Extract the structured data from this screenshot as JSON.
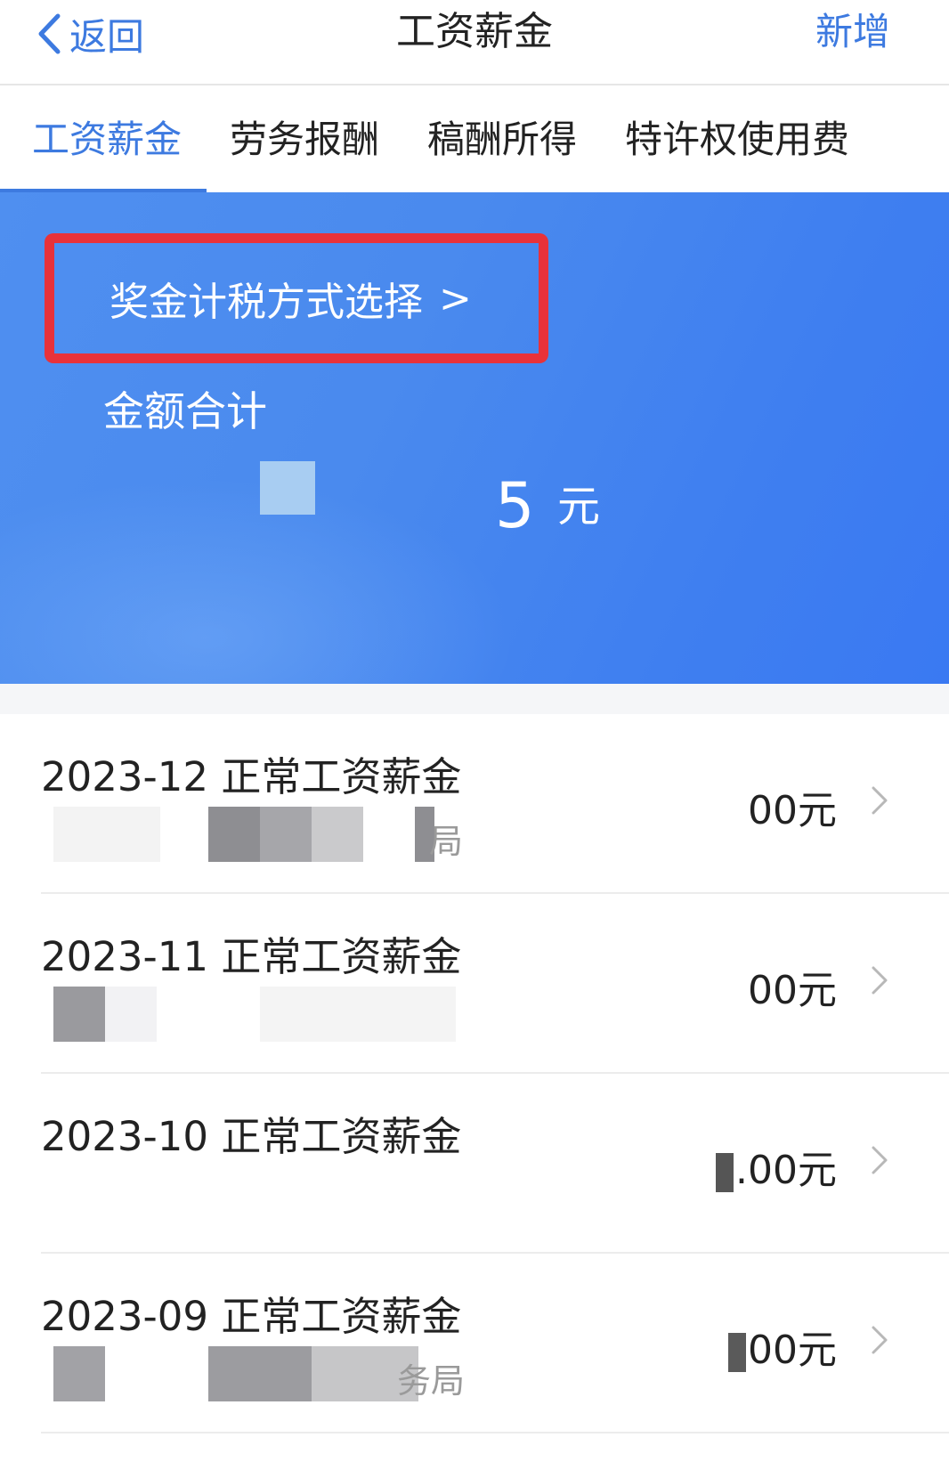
{
  "header": {
    "back_label": "返回",
    "title": "工资薪金",
    "add_label": "新增"
  },
  "tabs": [
    {
      "label": "工资薪金",
      "active": true
    },
    {
      "label": "劳务报酬",
      "active": false
    },
    {
      "label": "稿酬所得",
      "active": false
    },
    {
      "label": "特许权使用费",
      "active": false
    }
  ],
  "banner": {
    "bonus_select_label": "奖金计税方式选择",
    "bonus_select_arrow": ">",
    "total_label": "金额合计",
    "total_amount_visible": "5",
    "total_unit": "元"
  },
  "records": [
    {
      "title": "2023-12 正常工资薪金",
      "sub_visible": "局",
      "amount_visible": "00元"
    },
    {
      "title": "2023-11 正常工资薪金",
      "sub_visible": "",
      "amount_visible": "00元"
    },
    {
      "title": "2023-10 正常工资薪金",
      "sub_visible": "",
      "amount_visible": ".00元"
    },
    {
      "title": "2023-09 正常工资薪金",
      "sub_visible": "务局",
      "amount_visible": "00元"
    }
  ],
  "colors": {
    "accent": "#3d7ae0",
    "banner": "#4a8aee",
    "highlight_box": "#e8323a"
  },
  "icons": {
    "back": "chevron-left-icon",
    "row_arrow": "chevron-right-icon"
  }
}
